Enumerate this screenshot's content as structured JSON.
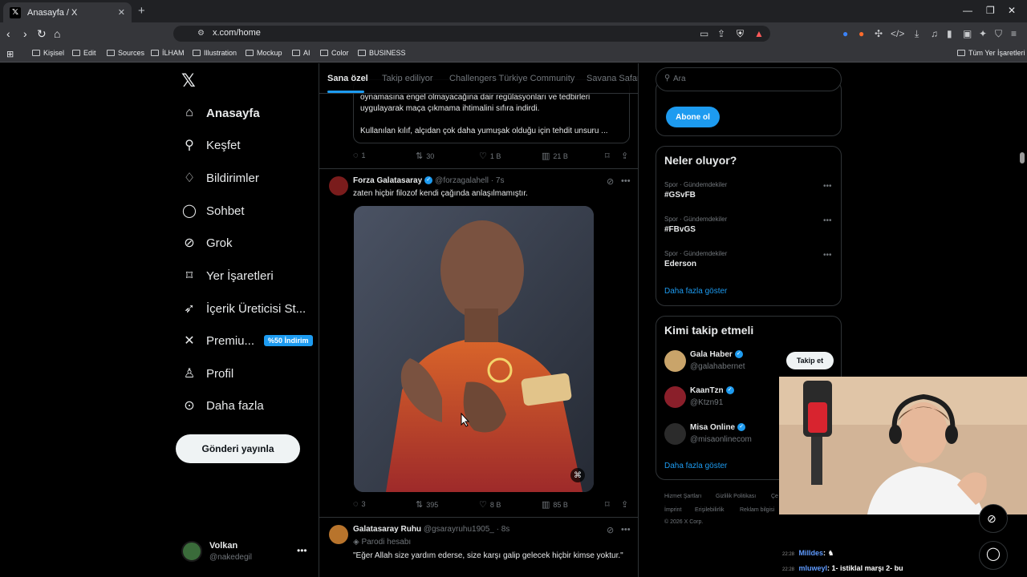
{
  "browser": {
    "tab_title": "Anasayfa / X",
    "url": "x.com/home",
    "bookmarks": [
      "Kişisel",
      "Edit",
      "Sources",
      "İLHAM",
      "Illustration",
      "Mockup",
      "AI",
      "Color",
      "BUSINESS"
    ],
    "all_bookmarks": "Tüm Yer İşaretleri"
  },
  "nav": {
    "logo": "X",
    "items": [
      {
        "label": "Anasayfa",
        "icon": "home-icon"
      },
      {
        "label": "Keşfet",
        "icon": "search-icon"
      },
      {
        "label": "Bildirimler",
        "icon": "bell-icon"
      },
      {
        "label": "Sohbet",
        "icon": "chat-icon"
      },
      {
        "label": "Grok",
        "icon": "grok-icon"
      },
      {
        "label": "Yer İşaretleri",
        "icon": "bookmark-icon"
      },
      {
        "label": "İçerik Üreticisi St...",
        "icon": "rocket-icon"
      },
      {
        "label": "Premiu...",
        "icon": "x-premium-icon"
      },
      {
        "label": "Profil",
        "icon": "person-icon"
      },
      {
        "label": "Daha fazla",
        "icon": "more-circle-icon"
      }
    ],
    "premium_badge": "%50 İndirim",
    "post_button": "Gönderi yayınla",
    "account": {
      "name": "Volkan",
      "handle": "@nakedegil"
    }
  },
  "feed": {
    "tabs": [
      "Sana özel",
      "Takip ediliyor",
      "Challengers Türkiye Community",
      "Savana Safari"
    ],
    "post0": {
      "quote_lines": [
        "oynamasına engel olmayacağına dair regülasyonları ve tedbirleri",
        "uygulayarak maça çıkmama ihtimalini sıfıra indirdi.",
        "Kullanılan kılıf, alçıdan çok daha yumuşak olduğu için tehdit unsuru ..."
      ],
      "stats": {
        "replies": "1",
        "reposts": "30",
        "likes": "1 B",
        "views": "21 B"
      }
    },
    "post1": {
      "name": "Forza Galatasaray",
      "handle": "@forzagalahell · 7s",
      "text": "zaten hiçbir filozof kendi çağında anlaşılmamıştır.",
      "image_alt": "Galatasaray player applauding in orange-red kit",
      "stats": {
        "replies": "3",
        "reposts": "395",
        "likes": "8 B",
        "views": "85 B"
      }
    },
    "post2": {
      "name": "Galatasaray Ruhu",
      "handle": "@gsarayruhu1905_ · 8s",
      "label": "Parodi hesabı",
      "text": "\"Eğer Allah size yardım ederse, size karşı galip gelecek hiçbir kimse yoktur.\""
    }
  },
  "sidebar": {
    "search_placeholder": "Ara",
    "subscribe_button": "Abone ol",
    "trends_title": "Neler oluyor?",
    "trends": [
      {
        "category": "Spor · Gündemdekiler",
        "name": "#GSvFB"
      },
      {
        "category": "Spor · Gündemdekiler",
        "name": "#FBvGS"
      },
      {
        "category": "Spor · Gündemdekiler",
        "name": "Ederson"
      }
    ],
    "show_more": "Daha fazla göster",
    "wtf_title": "Kimi takip etmeli",
    "who_to_follow": [
      {
        "name": "Gala Haber",
        "handle": "@galahabernet"
      },
      {
        "name": "KaanTzn",
        "handle": "@Ktzn91"
      },
      {
        "name": "Misa Online",
        "handle": "@misaonlinecom"
      }
    ],
    "follow_button": "Takip et",
    "footer": {
      "line1": [
        "Hizmet Şartları",
        "Gizlilik Politikası",
        "Çe"
      ],
      "line2": [
        "İmprint",
        "Erişilebilirlik",
        "Reklam bilgisi"
      ],
      "copyright": "© 2026 X Corp."
    }
  },
  "stream_chat": [
    {
      "time": "22:28",
      "user": "Milldes",
      "msg": ""
    },
    {
      "time": "22:28",
      "user": "mluweyl",
      "msg": "1- istiklal marşı 2- bu"
    }
  ],
  "colors": {
    "accent": "#1d9bf0",
    "background": "#000000",
    "border": "#2f3336",
    "muted": "#71767b"
  }
}
